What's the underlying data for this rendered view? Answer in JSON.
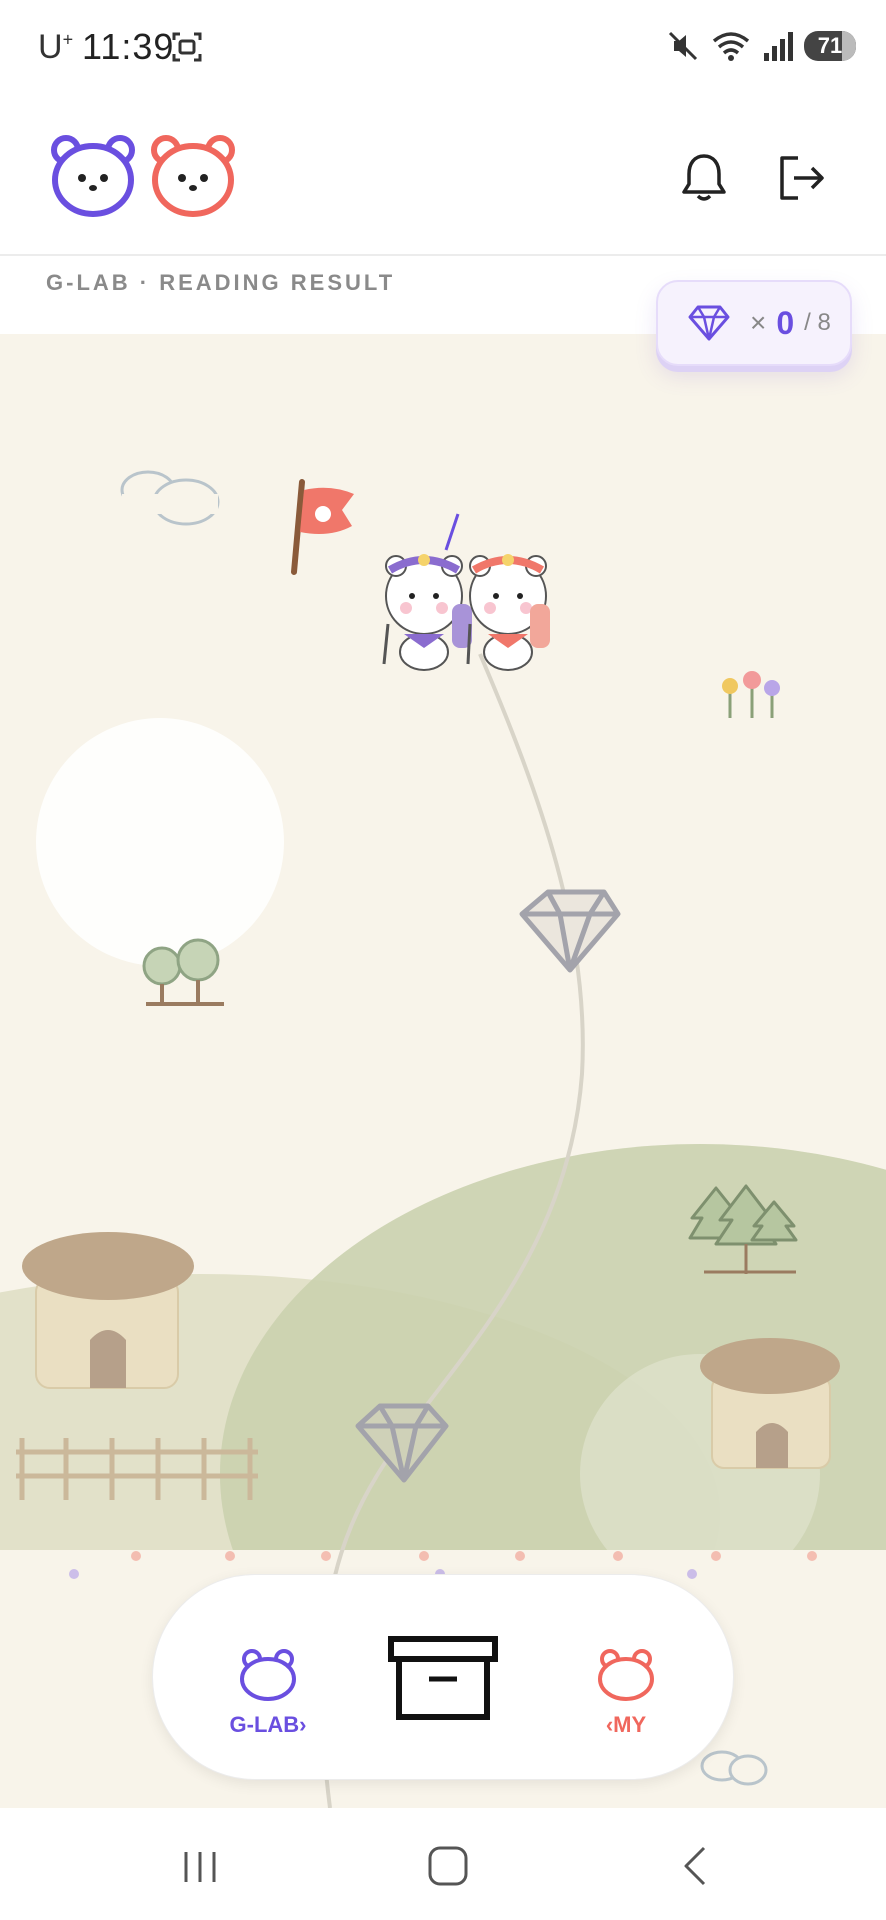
{
  "status_bar": {
    "carrier": "U",
    "carrier_sup": "+",
    "time": "11:39",
    "battery": "71",
    "icons": [
      "screenshot-icon",
      "mute-icon",
      "wifi-icon",
      "signal-icon",
      "battery-icon"
    ]
  },
  "header": {
    "logos": [
      "purple-bear-logo",
      "coral-bear-logo"
    ],
    "actions": [
      "bell-icon",
      "logout-icon"
    ]
  },
  "subtitle": "G-LAB · READING RESULT",
  "gem_counter": {
    "times": "×",
    "count": "0",
    "total": "/ 8"
  },
  "tabs": {
    "glab_label": "G-LAB›",
    "my_label": "‹MY"
  },
  "colors": {
    "purple": "#6a4fe0",
    "coral": "#f0675d",
    "map_bg": "#f8f4ea",
    "hill": "#cdd3b2"
  }
}
